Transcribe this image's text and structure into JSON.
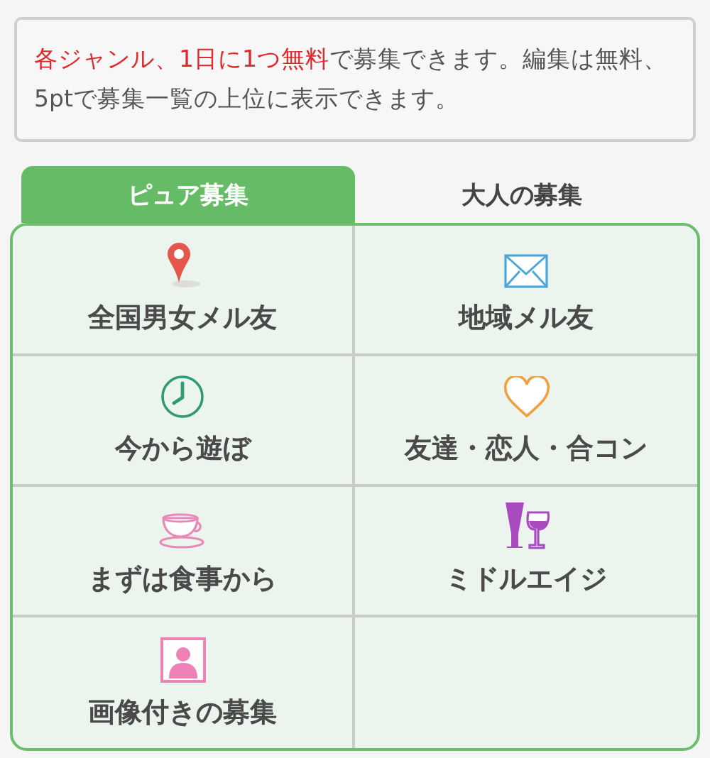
{
  "notice": {
    "highlight": "各ジャンル、1日に1つ無料",
    "text": "で募集できます。編集は無料、5ptで募集一覧の上位に表示できます。"
  },
  "tabs": [
    {
      "label": "ピュア募集",
      "selected": true
    },
    {
      "label": "大人の募集",
      "selected": false
    }
  ],
  "categories": [
    {
      "kind": "pin",
      "label": "全国男女メル友"
    },
    {
      "kind": "mail",
      "label": "地域メル友"
    },
    {
      "kind": "clock",
      "label": "今から遊ぼ"
    },
    {
      "kind": "heart",
      "label": "友達・恋人・合コン"
    },
    {
      "kind": "cup",
      "label": "まずは食事から"
    },
    {
      "kind": "wine",
      "label": "ミドルエイジ"
    },
    {
      "kind": "photo",
      "label": "画像付きの募集"
    }
  ]
}
